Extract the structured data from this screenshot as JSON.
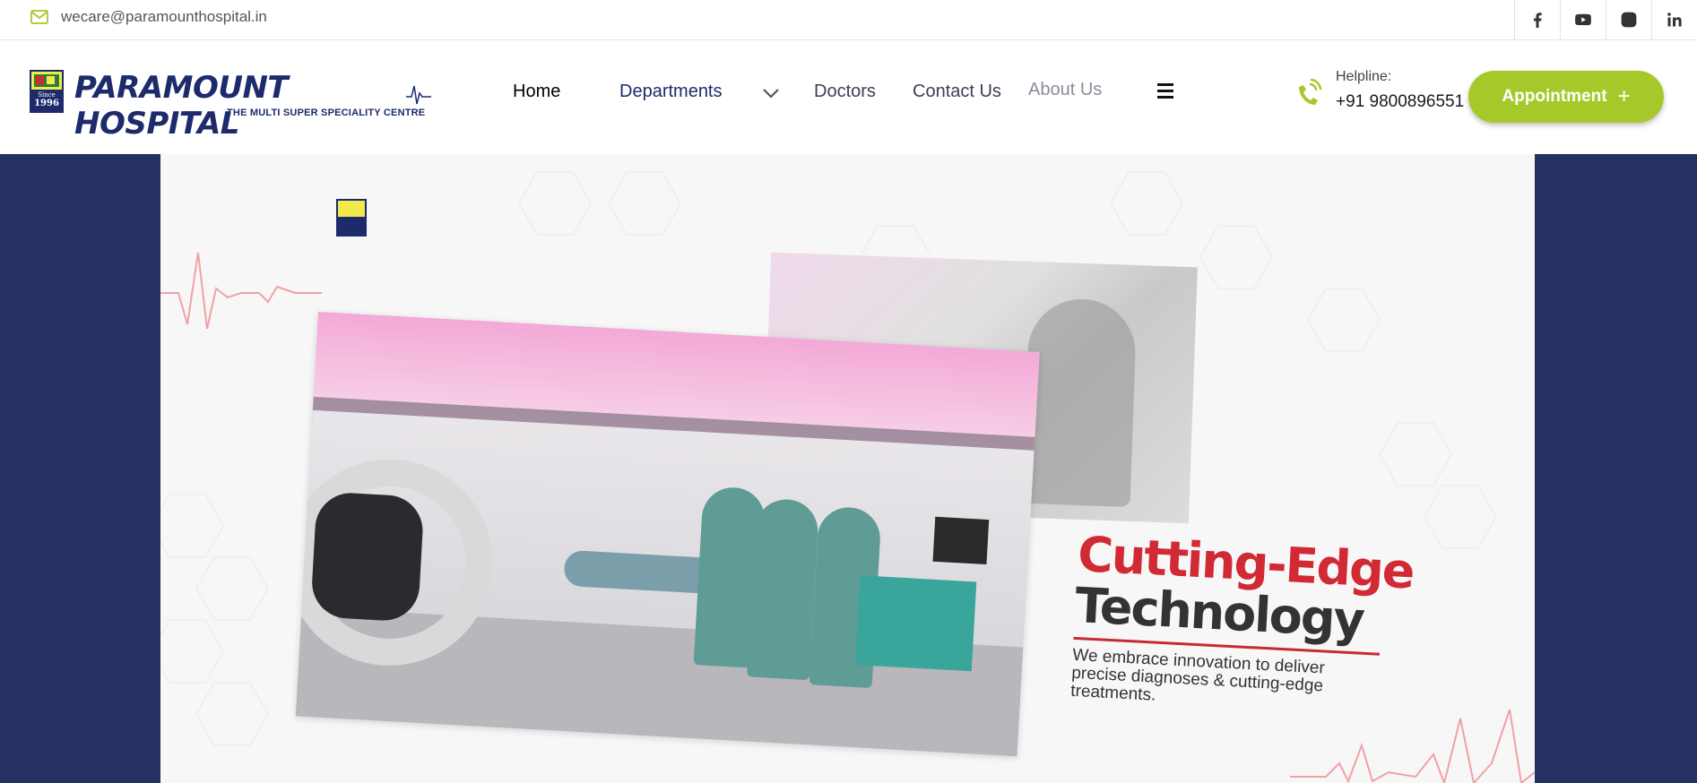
{
  "topbar": {
    "email": "wecare@paramounthospital.in",
    "socials": [
      "facebook",
      "youtube",
      "instagram",
      "linkedin"
    ]
  },
  "header": {
    "logo": {
      "name": "PARAMOUNT HOSPITAL",
      "tagline": "THE MULTI SUPER SPECIALITY CENTRE",
      "badge_since": "Since",
      "badge_year": "1996"
    },
    "nav": {
      "home": "Home",
      "departments": "Departments",
      "doctors": "Doctors",
      "contact": "Contact Us",
      "about": "About Us"
    },
    "helpline": {
      "label": "Helpline:",
      "number": "+91 9800896551"
    },
    "appointment_label": "Appointment",
    "appointment_icon": "+"
  },
  "hero": {
    "heading_line1": "Cutting-Edge",
    "heading_line2": "Technology",
    "description": "We embrace innovation to deliver precise diagnoses & cutting-edge treatments."
  },
  "colors": {
    "brand_navy": "#1d2a6b",
    "accent_green": "#a6c92a",
    "hero_bg": "#263163",
    "headline_red": "#d12a35"
  }
}
